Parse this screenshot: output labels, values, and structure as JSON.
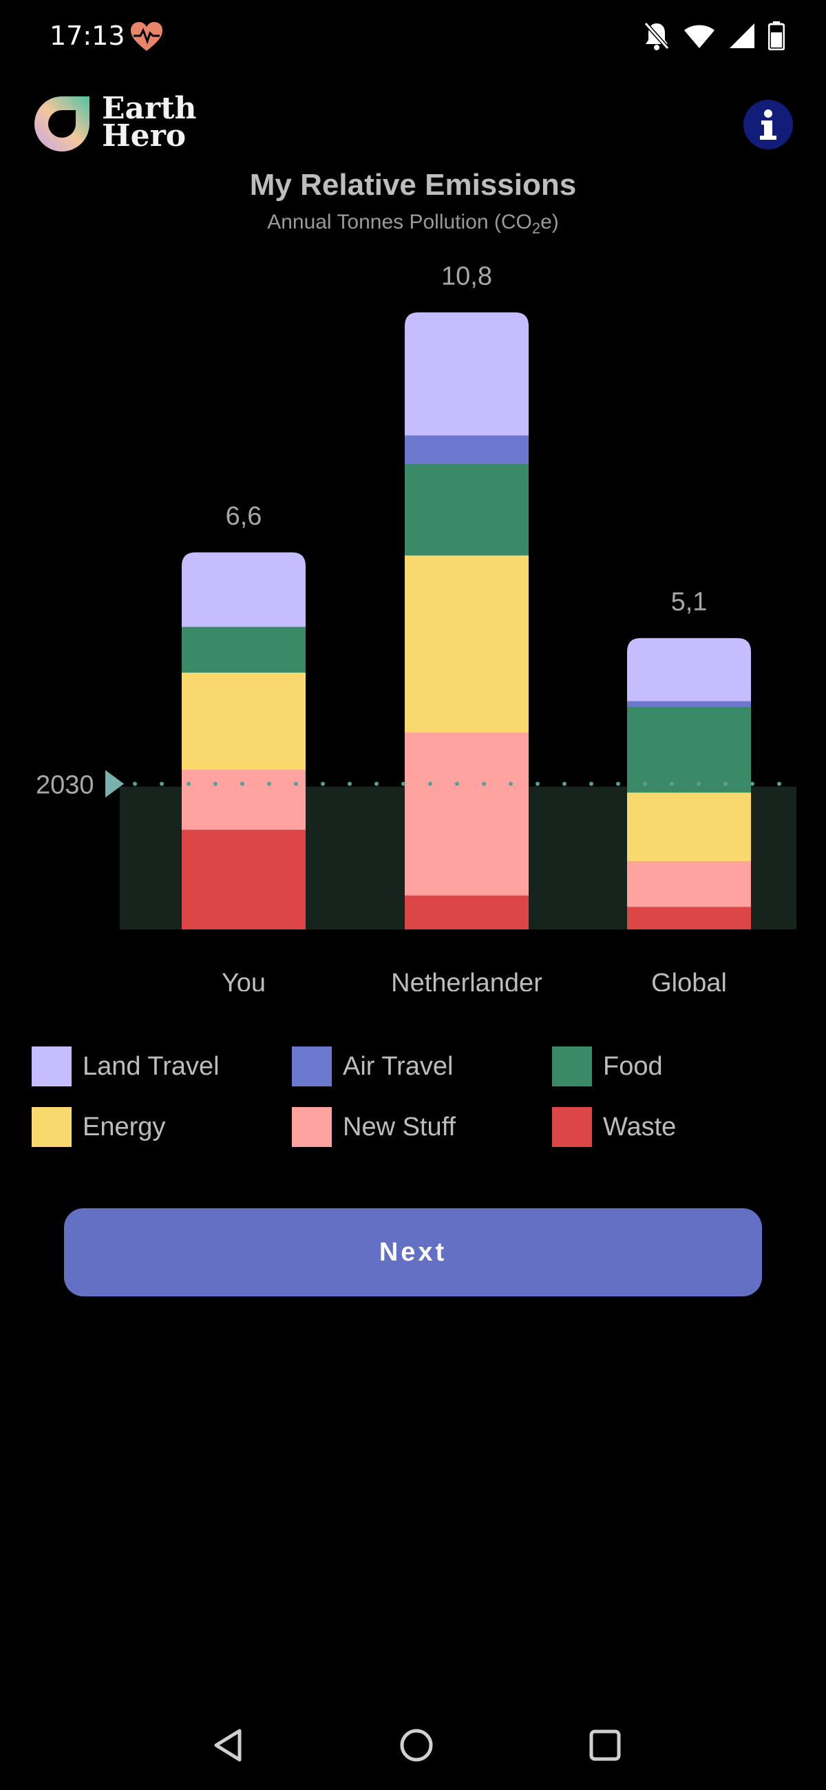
{
  "status": {
    "time": "17:13"
  },
  "header": {
    "brand_line1": "Earth",
    "brand_line2": "Hero",
    "info_icon": "info-icon"
  },
  "chart_title": "My Relative Emissions",
  "chart_subtitle_main": "Annual Tonnes Pollution (CO",
  "chart_subtitle_sub": "2",
  "chart_subtitle_end": "e)",
  "chart_data": {
    "type": "bar",
    "stacked": true,
    "categories": [
      "You",
      "Netherlander",
      "Global"
    ],
    "totals_labels": [
      "6,6",
      "10,8",
      "5,1"
    ],
    "totals": [
      6.6,
      10.8,
      5.1
    ],
    "ylim": [
      0,
      10.8
    ],
    "reference_line": {
      "label": "2030",
      "value": 2.5
    },
    "series": [
      {
        "name": "Waste",
        "color": "#dd4646",
        "values": [
          1.75,
          0.6,
          0.4
        ]
      },
      {
        "name": "New Stuff",
        "color": "#ffa3a0",
        "values": [
          1.05,
          2.85,
          0.8
        ]
      },
      {
        "name": "Energy",
        "color": "#f9d86d",
        "values": [
          1.7,
          3.1,
          1.2
        ]
      },
      {
        "name": "Food",
        "color": "#3a8a68",
        "values": [
          0.8,
          1.6,
          1.5
        ]
      },
      {
        "name": "Air Travel",
        "color": "#6c78ce",
        "values": [
          0.0,
          0.5,
          0.1
        ]
      },
      {
        "name": "Land Travel",
        "color": "#c5bdff",
        "values": [
          1.3,
          2.15,
          1.1
        ]
      }
    ]
  },
  "legend": [
    {
      "name": "Land Travel",
      "color": "#c5bdff"
    },
    {
      "name": "Air Travel",
      "color": "#6c78ce"
    },
    {
      "name": "Food",
      "color": "#3a8a68"
    },
    {
      "name": "Energy",
      "color": "#f9d86d"
    },
    {
      "name": "New Stuff",
      "color": "#ffa3a0"
    },
    {
      "name": "Waste",
      "color": "#dd4646"
    }
  ],
  "next_label": "Next",
  "nav": {
    "back_icon": "back-triangle-icon",
    "home_icon": "home-circle-icon",
    "recents_icon": "recents-square-icon"
  }
}
